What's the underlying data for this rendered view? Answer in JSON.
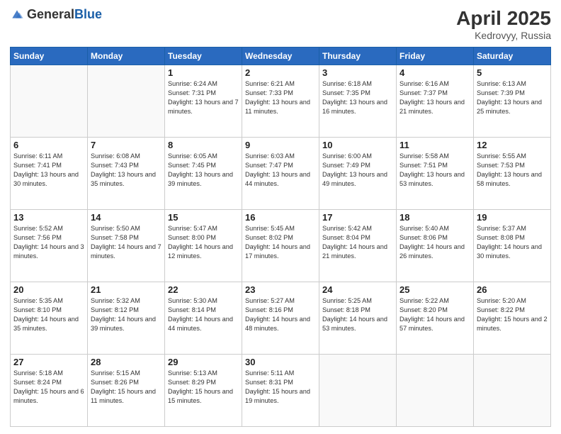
{
  "header": {
    "logo_general": "General",
    "logo_blue": "Blue",
    "title": "April 2025",
    "location": "Kedrovyy, Russia"
  },
  "weekdays": [
    "Sunday",
    "Monday",
    "Tuesday",
    "Wednesday",
    "Thursday",
    "Friday",
    "Saturday"
  ],
  "weeks": [
    [
      {
        "day": "",
        "info": ""
      },
      {
        "day": "",
        "info": ""
      },
      {
        "day": "1",
        "info": "Sunrise: 6:24 AM\nSunset: 7:31 PM\nDaylight: 13 hours and 7 minutes."
      },
      {
        "day": "2",
        "info": "Sunrise: 6:21 AM\nSunset: 7:33 PM\nDaylight: 13 hours and 11 minutes."
      },
      {
        "day": "3",
        "info": "Sunrise: 6:18 AM\nSunset: 7:35 PM\nDaylight: 13 hours and 16 minutes."
      },
      {
        "day": "4",
        "info": "Sunrise: 6:16 AM\nSunset: 7:37 PM\nDaylight: 13 hours and 21 minutes."
      },
      {
        "day": "5",
        "info": "Sunrise: 6:13 AM\nSunset: 7:39 PM\nDaylight: 13 hours and 25 minutes."
      }
    ],
    [
      {
        "day": "6",
        "info": "Sunrise: 6:11 AM\nSunset: 7:41 PM\nDaylight: 13 hours and 30 minutes."
      },
      {
        "day": "7",
        "info": "Sunrise: 6:08 AM\nSunset: 7:43 PM\nDaylight: 13 hours and 35 minutes."
      },
      {
        "day": "8",
        "info": "Sunrise: 6:05 AM\nSunset: 7:45 PM\nDaylight: 13 hours and 39 minutes."
      },
      {
        "day": "9",
        "info": "Sunrise: 6:03 AM\nSunset: 7:47 PM\nDaylight: 13 hours and 44 minutes."
      },
      {
        "day": "10",
        "info": "Sunrise: 6:00 AM\nSunset: 7:49 PM\nDaylight: 13 hours and 49 minutes."
      },
      {
        "day": "11",
        "info": "Sunrise: 5:58 AM\nSunset: 7:51 PM\nDaylight: 13 hours and 53 minutes."
      },
      {
        "day": "12",
        "info": "Sunrise: 5:55 AM\nSunset: 7:53 PM\nDaylight: 13 hours and 58 minutes."
      }
    ],
    [
      {
        "day": "13",
        "info": "Sunrise: 5:52 AM\nSunset: 7:56 PM\nDaylight: 14 hours and 3 minutes."
      },
      {
        "day": "14",
        "info": "Sunrise: 5:50 AM\nSunset: 7:58 PM\nDaylight: 14 hours and 7 minutes."
      },
      {
        "day": "15",
        "info": "Sunrise: 5:47 AM\nSunset: 8:00 PM\nDaylight: 14 hours and 12 minutes."
      },
      {
        "day": "16",
        "info": "Sunrise: 5:45 AM\nSunset: 8:02 PM\nDaylight: 14 hours and 17 minutes."
      },
      {
        "day": "17",
        "info": "Sunrise: 5:42 AM\nSunset: 8:04 PM\nDaylight: 14 hours and 21 minutes."
      },
      {
        "day": "18",
        "info": "Sunrise: 5:40 AM\nSunset: 8:06 PM\nDaylight: 14 hours and 26 minutes."
      },
      {
        "day": "19",
        "info": "Sunrise: 5:37 AM\nSunset: 8:08 PM\nDaylight: 14 hours and 30 minutes."
      }
    ],
    [
      {
        "day": "20",
        "info": "Sunrise: 5:35 AM\nSunset: 8:10 PM\nDaylight: 14 hours and 35 minutes."
      },
      {
        "day": "21",
        "info": "Sunrise: 5:32 AM\nSunset: 8:12 PM\nDaylight: 14 hours and 39 minutes."
      },
      {
        "day": "22",
        "info": "Sunrise: 5:30 AM\nSunset: 8:14 PM\nDaylight: 14 hours and 44 minutes."
      },
      {
        "day": "23",
        "info": "Sunrise: 5:27 AM\nSunset: 8:16 PM\nDaylight: 14 hours and 48 minutes."
      },
      {
        "day": "24",
        "info": "Sunrise: 5:25 AM\nSunset: 8:18 PM\nDaylight: 14 hours and 53 minutes."
      },
      {
        "day": "25",
        "info": "Sunrise: 5:22 AM\nSunset: 8:20 PM\nDaylight: 14 hours and 57 minutes."
      },
      {
        "day": "26",
        "info": "Sunrise: 5:20 AM\nSunset: 8:22 PM\nDaylight: 15 hours and 2 minutes."
      }
    ],
    [
      {
        "day": "27",
        "info": "Sunrise: 5:18 AM\nSunset: 8:24 PM\nDaylight: 15 hours and 6 minutes."
      },
      {
        "day": "28",
        "info": "Sunrise: 5:15 AM\nSunset: 8:26 PM\nDaylight: 15 hours and 11 minutes."
      },
      {
        "day": "29",
        "info": "Sunrise: 5:13 AM\nSunset: 8:29 PM\nDaylight: 15 hours and 15 minutes."
      },
      {
        "day": "30",
        "info": "Sunrise: 5:11 AM\nSunset: 8:31 PM\nDaylight: 15 hours and 19 minutes."
      },
      {
        "day": "",
        "info": ""
      },
      {
        "day": "",
        "info": ""
      },
      {
        "day": "",
        "info": ""
      }
    ]
  ]
}
